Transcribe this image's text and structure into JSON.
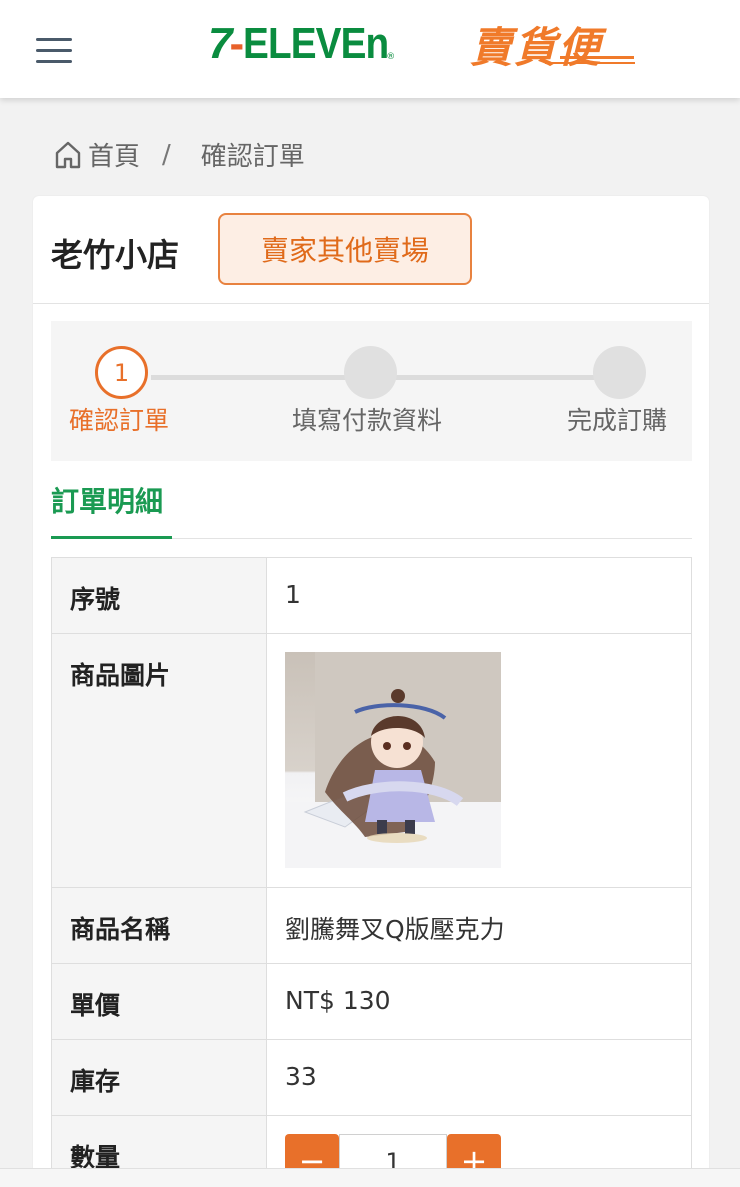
{
  "header": {
    "menu_icon": "hamburger-icon",
    "logo_brand": "7-ELEVEN",
    "logo_sub": "賣貨便"
  },
  "breadcrumb": {
    "home_icon": "home-icon",
    "home": "首頁",
    "separator": "/",
    "current": "確認訂單"
  },
  "shop": {
    "name": "老竹小店",
    "other_button": "賣家其他賣場"
  },
  "steps": [
    {
      "number": "1",
      "label": "確認訂單",
      "active": true
    },
    {
      "number": "",
      "label": "填寫付款資料",
      "active": false
    },
    {
      "number": "",
      "label": "完成訂購",
      "active": false
    }
  ],
  "section": {
    "title": "訂單明細"
  },
  "details": {
    "serial_label": "序號",
    "serial_value": "1",
    "image_label": "商品圖片",
    "name_label": "商品名稱",
    "name_value": "劉騰舞叉Q版壓克力",
    "price_label": "單價",
    "price_value": "NT$ 130",
    "stock_label": "庫存",
    "stock_value": "33",
    "qty_label": "數量",
    "qty_value": "1",
    "qty_minus": "−",
    "qty_plus": "+"
  },
  "colors": {
    "brand_green": "#1a9a52",
    "accent_orange": "#e8702a"
  }
}
